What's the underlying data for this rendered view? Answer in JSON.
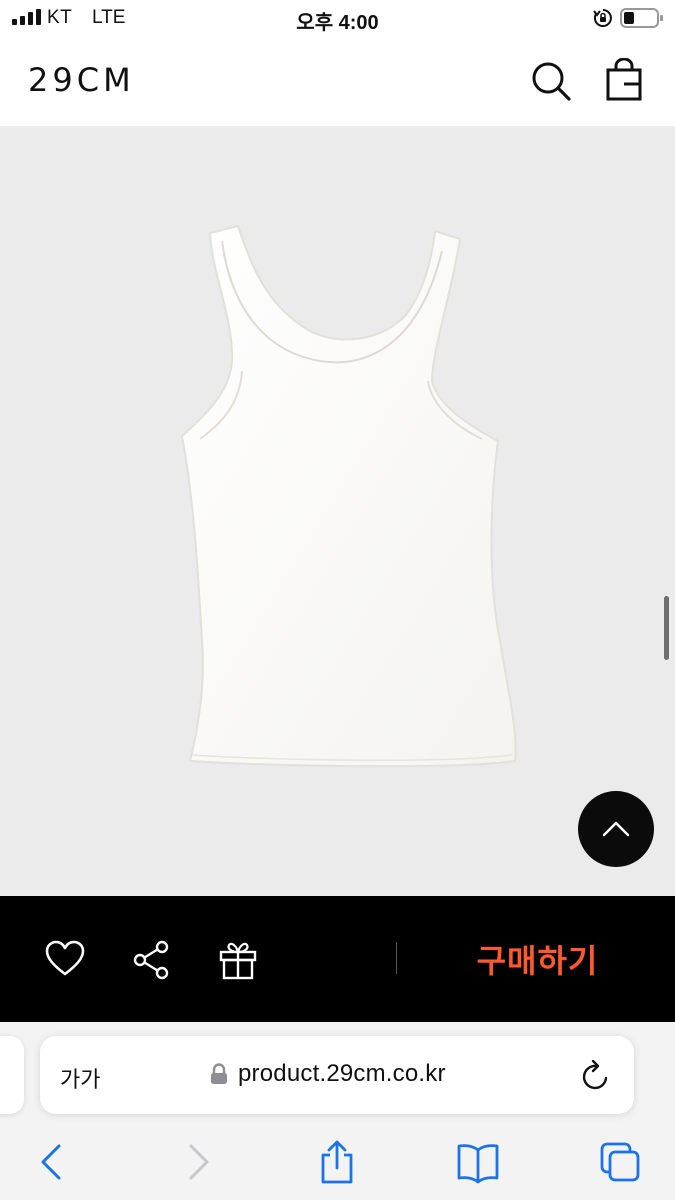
{
  "status_bar": {
    "carrier": "KT",
    "network": "LTE",
    "time": "오후 4:00"
  },
  "header": {
    "logo": "29CM",
    "search_icon": "search-icon",
    "bag_icon": "shopping-bag-icon"
  },
  "product": {
    "image": "white-tank-top",
    "background_color": "#ebebec"
  },
  "action_bar": {
    "icons": [
      "heart-icon",
      "share-icon",
      "gift-icon"
    ],
    "buy_label": "구매하기",
    "buy_color": "#ff5a2d"
  },
  "browser": {
    "text_size_label": "가가",
    "url": "product.29cm.co.kr",
    "toolbar_icons": [
      "back-icon",
      "forward-icon",
      "share-icon",
      "bookmarks-icon",
      "tabs-icon"
    ],
    "accent": "#1a73e8"
  }
}
